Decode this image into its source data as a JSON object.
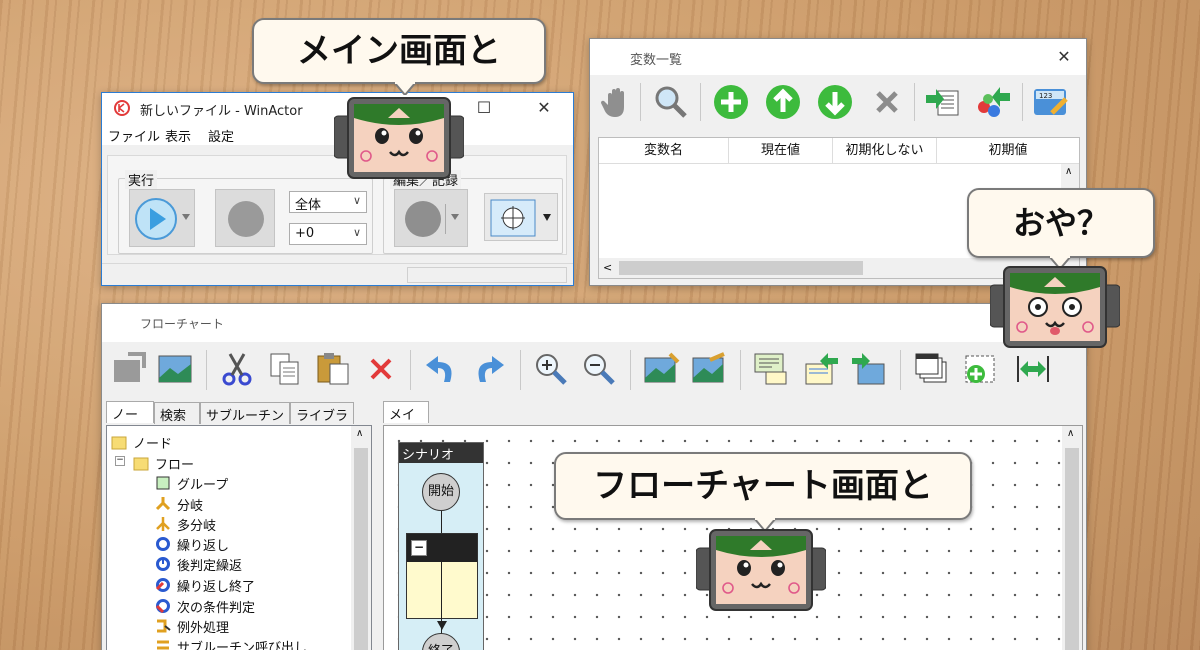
{
  "main_window": {
    "title": "新しいファイル - WinActor",
    "menu": [
      "ファイル",
      "表示",
      "設定"
    ],
    "group_run": "実行",
    "group_edit": "編集／記録",
    "combo_scope": "全体",
    "combo_offset": "+0"
  },
  "variables_window": {
    "title": "変数一覧",
    "columns": [
      "変数名",
      "現在値",
      "初期化しない",
      "初期値"
    ]
  },
  "flowchart_window": {
    "title": "フローチャート",
    "left_tabs": [
      "ノード",
      "検索",
      "サブルーチン",
      "ライブラリ"
    ],
    "tree": {
      "root": "ノード",
      "flow": "フロー",
      "items": [
        "グループ",
        "分岐",
        "多分岐",
        "繰り返し",
        "後判定繰返",
        "繰り返し終了",
        "次の条件判定",
        "例外処理",
        "サブルーチン呼び出し"
      ]
    },
    "main_tab": "メイン",
    "scenario": {
      "title": "シナリオ",
      "start": "開始",
      "end": "終了"
    }
  },
  "bubbles": {
    "main": "メイン画面と",
    "oya": "おや？",
    "flow": "フローチャート画面と"
  },
  "colors": {
    "green_button": "#3dbb3d",
    "titlebar_border": "#2b7cd3",
    "bubble_bg": "#fff9ee"
  }
}
